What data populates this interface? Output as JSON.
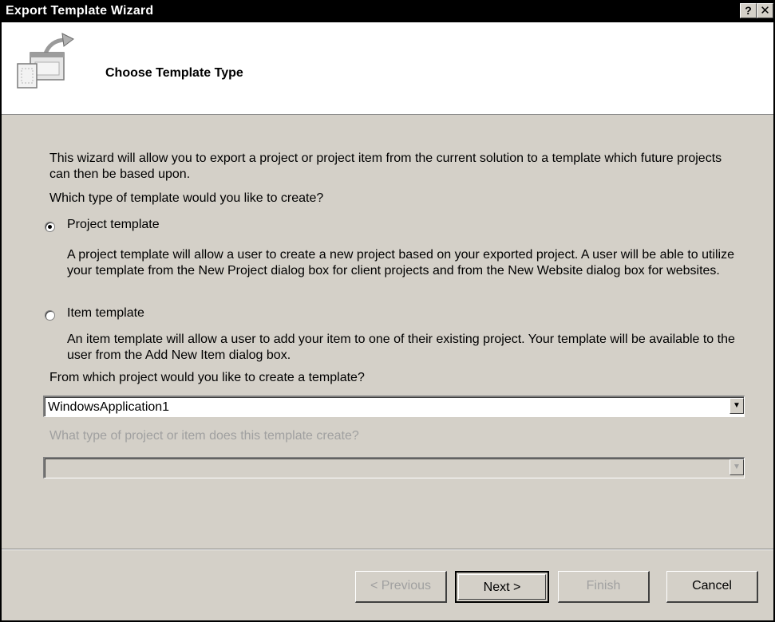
{
  "window": {
    "title": "Export Template Wizard",
    "help_label": "?",
    "close_label": "✕"
  },
  "header": {
    "title": "Choose Template Type",
    "icon": "template-wizard-icon"
  },
  "intro": "This wizard will allow you to export a project or project item from the current solution to a template which future projects can then be based upon.",
  "question": "Which type of template would you like to create?",
  "options": {
    "project": {
      "label": "Project template",
      "selected": true,
      "description": "A project template will allow a user to create a new project based on your exported project. A user will be able to utilize your template from the New Project dialog box for client projects and from the New Website dialog box for websites."
    },
    "item": {
      "label": "Item template",
      "selected": false,
      "description": "An item template will allow a user to add your item to one of their existing project. Your template will be available to the user from the Add New Item dialog box."
    }
  },
  "source": {
    "label": "From which project would you like to create a template?",
    "value": "WindowsApplication1"
  },
  "type": {
    "label": "What type of project or item does this template create?",
    "value": ""
  },
  "buttons": {
    "previous": "< Previous",
    "next": "Next >",
    "finish": "Finish",
    "cancel": "Cancel"
  },
  "colors": {
    "dialog_bg": "#d4d0c8",
    "title_bar": "#000000",
    "disabled_text": "#a0a0a0"
  }
}
